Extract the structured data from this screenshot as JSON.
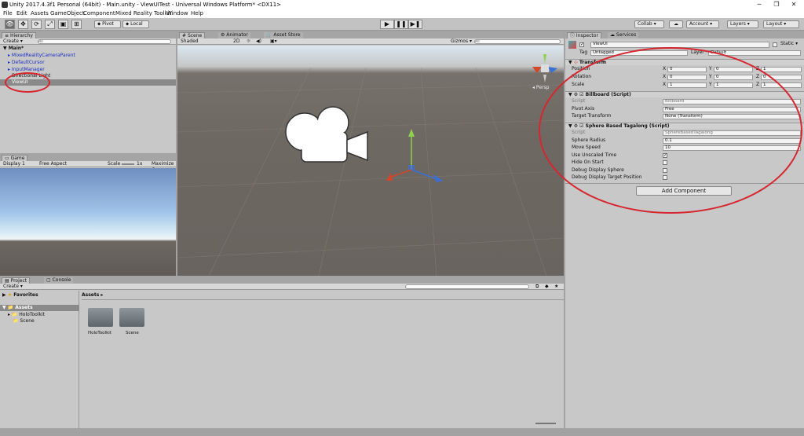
{
  "window": {
    "title": "Unity 2017.4.3f1 Personal (64bit) - Main.unity - ViewUITest - Universal Windows Platform* <DX11>",
    "controls": [
      "─",
      "❐",
      "✕"
    ]
  },
  "menu": [
    "File",
    "Edit",
    "Assets",
    "GameObject",
    "Component",
    "Mixed Reality Toolkit",
    "Window",
    "Help"
  ],
  "toolbar": {
    "pivot": "Pivot",
    "local": "Local",
    "collab": "Collab ▾",
    "account": "Account ▾",
    "layers": "Layers ▾",
    "layout": "Layout ▾",
    "cloud_icon": "cloud-icon"
  },
  "hierarchy": {
    "tab": "Hierarchy",
    "create": "Create ▾",
    "search_placeholder": "All",
    "scene": "Main*",
    "items": [
      "MixedRealityCameraParent",
      "DefaultCursor",
      "InputManager",
      "Directional Light",
      "ViewUI"
    ]
  },
  "scene": {
    "tabs": [
      "Scene",
      "Animator",
      "Asset Store"
    ],
    "shading": "Shaded",
    "mode_2d": "2D",
    "gizmos": "Gizmos ▾",
    "search_placeholder": "All",
    "persp": "Persp"
  },
  "game": {
    "tab": "Game",
    "display": "Display 1",
    "aspect": "Free Aspect",
    "scale_label": "Scale",
    "scale_value": "1x",
    "maximize": "Maximize C"
  },
  "project": {
    "tabs": [
      "Project",
      "Console"
    ],
    "create": "Create ▾",
    "favorites": "Favorites",
    "assets_root": "Assets",
    "tree": [
      "HoloToolkit",
      "Scene"
    ],
    "breadcrumb": "Assets ▸",
    "folders": [
      "HoloToolkit",
      "Scene"
    ]
  },
  "inspector": {
    "tabs": [
      "Inspector",
      "Services"
    ],
    "object_name": "ViewUI",
    "static_label": "Static ▾",
    "tag_label": "Tag",
    "tag_value": "Untagged",
    "layer_label": "Layer",
    "layer_value": "Default",
    "transform": {
      "title": "Transform",
      "rows": [
        {
          "label": "Position",
          "x": "0",
          "y": "0",
          "z": "1"
        },
        {
          "label": "Rotation",
          "x": "0",
          "y": "0",
          "z": "0"
        },
        {
          "label": "Scale",
          "x": "1",
          "y": "1",
          "z": "1"
        }
      ]
    },
    "billboard": {
      "title": "Billboard (Script)",
      "script_label": "Script",
      "script_value": "Billboard",
      "pivot_label": "Pivot Axis",
      "pivot_value": "Free",
      "target_label": "Target Transform",
      "target_value": "None (Transform)"
    },
    "tagalong": {
      "title": "Sphere Based Tagalong (Script)",
      "script_label": "Script",
      "script_value": "SphereBasedTagalong",
      "radius_label": "Sphere Radius",
      "radius_value": "0.1",
      "speed_label": "Move Speed",
      "speed_value": "10",
      "unscaled_label": "Use Unscaled Time",
      "hide_label": "Hide On Start",
      "debug_sphere_label": "Debug Display Sphere",
      "debug_target_label": "Debug Display Target Position",
      "checks": {
        "unscaled": true,
        "hide": false,
        "debug_sphere": false,
        "debug_target": false
      }
    },
    "add_component": "Add Component"
  },
  "colors": {
    "annotation": "#d6262f",
    "scene_ground": "#6e6862",
    "sky": "#bfdcf0"
  }
}
